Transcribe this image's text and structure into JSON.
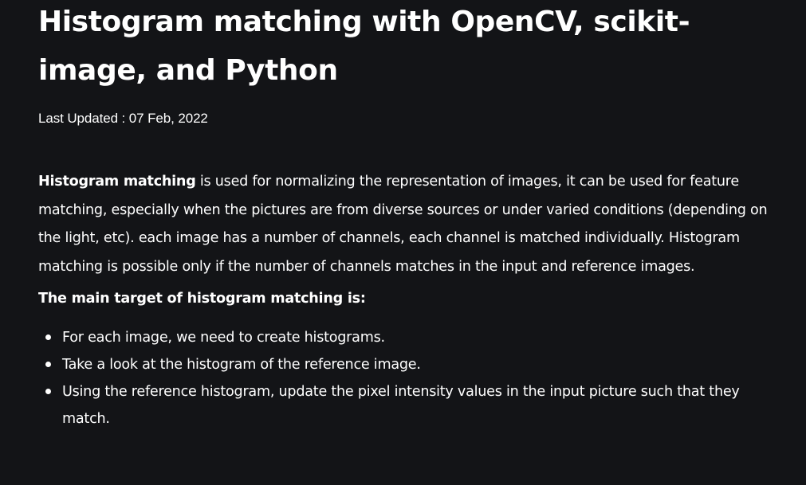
{
  "article": {
    "title": "Histogram matching with OpenCV, scikit-image, and Python",
    "last_updated": "Last Updated : 07 Feb, 2022",
    "intro_bold": "Histogram matching",
    "intro_rest": " is used for normalizing the representation of images, it can be used for feature matching, especially when the pictures are from diverse sources or under varied conditions (depending on the light, etc). each image has a number of channels, each channel is matched individually. Histogram matching is possible only if the number of channels matches in the input and reference images.",
    "subheading": "The main target of histogram matching is:",
    "bullets": [
      "For each image, we need to create histograms.",
      "Take a look at the histogram of the reference image.",
      "Using the reference histogram, update the pixel intensity values in the input picture such that they match."
    ]
  },
  "colors": {
    "background": "#131417",
    "text": "#ffffff"
  }
}
